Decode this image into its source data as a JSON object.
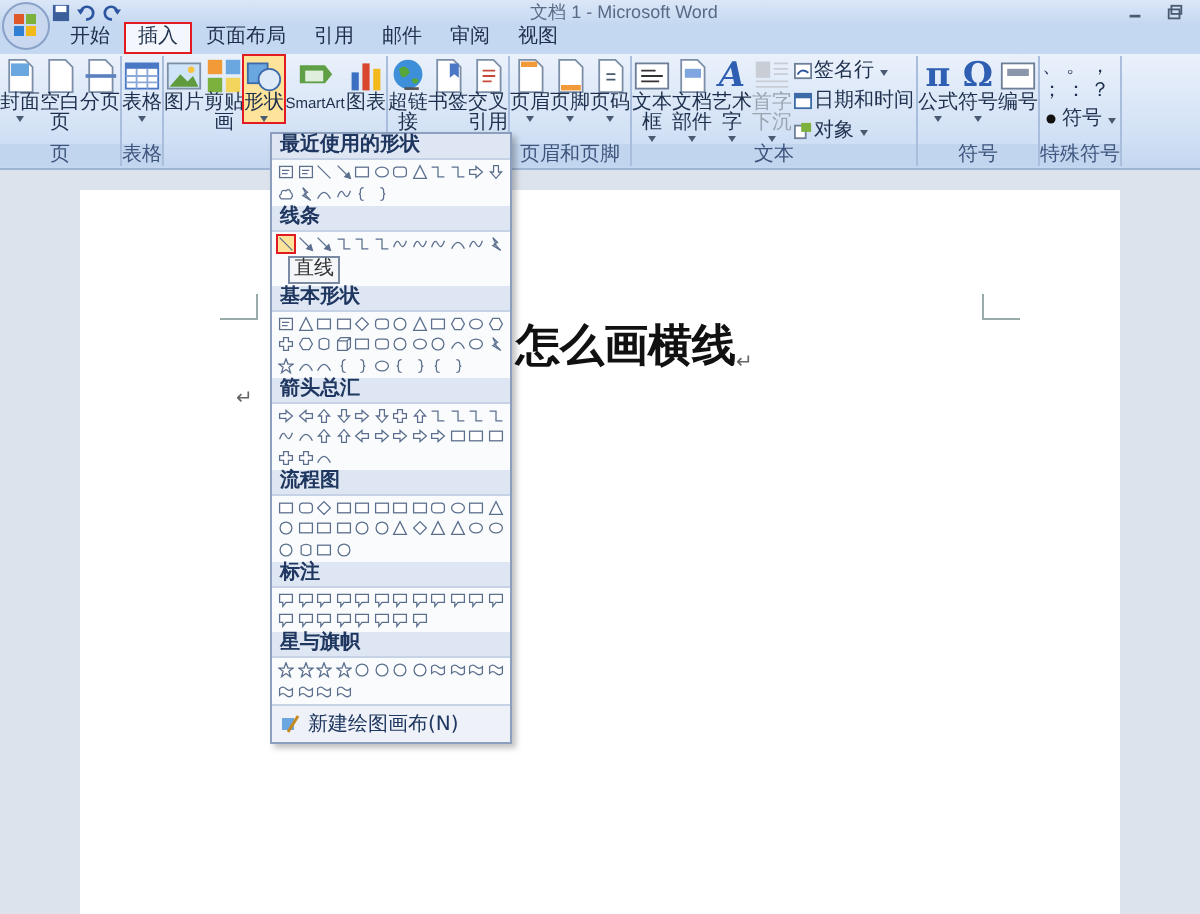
{
  "window": {
    "title": "文档 1 - Microsoft Word"
  },
  "tabs": [
    {
      "label": "开始",
      "selected": false
    },
    {
      "label": "插入",
      "selected": true
    },
    {
      "label": "页面布局",
      "selected": false
    },
    {
      "label": "引用",
      "selected": false
    },
    {
      "label": "邮件",
      "selected": false
    },
    {
      "label": "审阅",
      "selected": false
    },
    {
      "label": "视图",
      "selected": false
    }
  ],
  "ribbon": {
    "groups": [
      {
        "label": "页",
        "buttons": [
          {
            "kind": "large",
            "label": "封面",
            "dropdown": true,
            "selected": false,
            "disabled": false
          },
          {
            "kind": "large",
            "label": "空白页",
            "dropdown": false,
            "selected": false,
            "disabled": false
          },
          {
            "kind": "large",
            "label": "分页",
            "dropdown": false,
            "selected": false,
            "disabled": false
          }
        ]
      },
      {
        "label": "表格",
        "buttons": [
          {
            "kind": "large",
            "label": "表格",
            "dropdown": true,
            "selected": false,
            "disabled": false
          }
        ]
      },
      {
        "buttons": [
          {
            "kind": "large",
            "label": "图片",
            "dropdown": false,
            "selected": false,
            "disabled": false
          },
          {
            "kind": "large",
            "label": "剪贴画",
            "dropdown": false,
            "selected": false,
            "disabled": false
          },
          {
            "kind": "large",
            "label": "形状",
            "dropdown": true,
            "selected": true,
            "disabled": false
          },
          {
            "kind": "large",
            "label": "SmartArt",
            "dropdown": false,
            "selected": false,
            "disabled": false
          },
          {
            "kind": "large",
            "label": "图表",
            "dropdown": false,
            "selected": false,
            "disabled": false
          }
        ]
      },
      {
        "buttons": [
          {
            "kind": "large",
            "label": "超链接",
            "dropdown": false,
            "selected": false,
            "disabled": false
          },
          {
            "kind": "large",
            "label": "书签",
            "dropdown": false,
            "selected": false,
            "disabled": false
          },
          {
            "kind": "large",
            "label": "交叉引用",
            "dropdown": false,
            "selected": false,
            "disabled": false
          }
        ]
      },
      {
        "label": "页眉和页脚",
        "buttons": [
          {
            "kind": "large",
            "label": "页眉",
            "dropdown": true,
            "selected": false,
            "disabled": false
          },
          {
            "kind": "large",
            "label": "页脚",
            "dropdown": true,
            "selected": false,
            "disabled": false
          },
          {
            "kind": "large",
            "label": "页码",
            "dropdown": true,
            "selected": false,
            "disabled": false
          }
        ]
      },
      {
        "label": "文本",
        "buttons": [
          {
            "kind": "large",
            "label": "文本框",
            "dropdown": true,
            "selected": false,
            "disabled": false
          },
          {
            "kind": "large",
            "label": "文档部件",
            "dropdown": true,
            "selected": false,
            "disabled": false
          },
          {
            "kind": "large",
            "label": "艺术字",
            "glyph": "A",
            "dropdown": true,
            "selected": false,
            "disabled": false
          },
          {
            "kind": "large",
            "label": "首字下沉",
            "dropdown": true,
            "selected": false,
            "disabled": true
          },
          {
            "kind": "small",
            "label": "签名行",
            "dropdown": true,
            "selected": false,
            "disabled": false
          },
          {
            "kind": "small",
            "label": "日期和时间",
            "dropdown": false,
            "selected": false,
            "disabled": false
          },
          {
            "kind": "small",
            "label": "对象",
            "dropdown": true,
            "selected": false,
            "disabled": false
          }
        ]
      },
      {
        "label": "符号",
        "buttons": [
          {
            "kind": "large",
            "label": "公式",
            "glyph": "π",
            "dropdown": true,
            "selected": false,
            "disabled": false
          },
          {
            "kind": "large",
            "label": "符号",
            "glyph": "Ω",
            "dropdown": true,
            "selected": false,
            "disabled": false
          },
          {
            "kind": "large",
            "label": "编号",
            "dropdown": false,
            "selected": false,
            "disabled": false
          }
        ]
      },
      {
        "label": "特殊符号",
        "symbols": [
          "、",
          "。",
          "，",
          "；",
          "：",
          "？"
        ],
        "buttons": [
          {
            "kind": "small",
            "label": "符号",
            "dropdown": true,
            "selected": false,
            "disabled": false
          }
        ]
      }
    ]
  },
  "shapes_menu": {
    "sections": [
      {
        "title": "最近使用的形状",
        "shapes": [
          {
            "kind": "textbox",
            "selected": false
          },
          {
            "kind": "textbox",
            "selected": false
          },
          {
            "kind": "line",
            "selected": false
          },
          {
            "kind": "aline",
            "selected": false
          },
          {
            "kind": "rect",
            "selected": false
          },
          {
            "kind": "oval",
            "selected": false
          },
          {
            "kind": "rrect",
            "selected": false
          },
          {
            "kind": "tri",
            "selected": false
          },
          {
            "kind": "elbow",
            "selected": false
          },
          {
            "kind": "elbow",
            "selected": false
          },
          {
            "kind": "rarrow",
            "selected": false
          },
          {
            "kind": "darrow",
            "selected": false
          },
          {
            "kind": "cloud",
            "selected": false
          },
          {
            "kind": "bolt",
            "selected": false
          },
          {
            "kind": "arc",
            "selected": false
          },
          {
            "kind": "curve",
            "selected": false
          },
          {
            "kind": "lbrace",
            "selected": false
          },
          {
            "kind": "rbrace",
            "selected": false
          }
        ]
      },
      {
        "title": "线条",
        "shapes": [
          {
            "kind": "line",
            "selected": true
          },
          {
            "kind": "aline",
            "selected": false
          },
          {
            "kind": "aline",
            "selected": false
          },
          {
            "kind": "elbow",
            "selected": false
          },
          {
            "kind": "elbow",
            "selected": false
          },
          {
            "kind": "elbow",
            "selected": false
          },
          {
            "kind": "curve",
            "selected": false
          },
          {
            "kind": "curve",
            "selected": false
          },
          {
            "kind": "curve",
            "selected": false
          },
          {
            "kind": "arc",
            "selected": false
          },
          {
            "kind": "curve",
            "selected": false
          },
          {
            "kind": "bolt",
            "selected": false
          }
        ]
      },
      {
        "title": "基本形状",
        "shapes": [
          {
            "kind": "textbox",
            "selected": false
          },
          {
            "kind": "tri",
            "selected": false
          },
          {
            "kind": "rect",
            "selected": false
          },
          {
            "kind": "rect",
            "selected": false
          },
          {
            "kind": "diamond",
            "selected": false
          },
          {
            "kind": "rrect",
            "selected": false
          },
          {
            "kind": "circle",
            "selected": false
          },
          {
            "kind": "tri",
            "selected": false
          },
          {
            "kind": "rect",
            "selected": false
          },
          {
            "kind": "hex",
            "selected": false
          },
          {
            "kind": "oval",
            "selected": false
          },
          {
            "kind": "hex",
            "selected": false
          },
          {
            "kind": "plus",
            "selected": false
          },
          {
            "kind": "hex",
            "selected": false
          },
          {
            "kind": "cyl",
            "selected": false
          },
          {
            "kind": "cube",
            "selected": false
          },
          {
            "kind": "rect",
            "selected": false
          },
          {
            "kind": "rrect",
            "selected": false
          },
          {
            "kind": "circle",
            "selected": false
          },
          {
            "kind": "oval",
            "selected": false
          },
          {
            "kind": "circle",
            "selected": false
          },
          {
            "kind": "arc",
            "selected": false
          },
          {
            "kind": "oval",
            "selected": false
          },
          {
            "kind": "bolt",
            "selected": false
          },
          {
            "kind": "star",
            "selected": false
          },
          {
            "kind": "arc",
            "selected": false
          },
          {
            "kind": "arc",
            "selected": false
          },
          {
            "kind": "lbrace",
            "selected": false
          },
          {
            "kind": "rbrace",
            "selected": false
          },
          {
            "kind": "oval",
            "selected": false
          },
          {
            "kind": "lbrace",
            "selected": false
          },
          {
            "kind": "rbrace",
            "selected": false
          },
          {
            "kind": "lbrace",
            "selected": false
          },
          {
            "kind": "rbrace",
            "selected": false
          }
        ]
      },
      {
        "title": "箭头总汇",
        "shapes": [
          {
            "kind": "rarrow",
            "selected": false
          },
          {
            "kind": "larrow",
            "selected": false
          },
          {
            "kind": "uarrow",
            "selected": false
          },
          {
            "kind": "darrow",
            "selected": false
          },
          {
            "kind": "rarrow",
            "selected": false
          },
          {
            "kind": "darrow",
            "selected": false
          },
          {
            "kind": "plus",
            "selected": false
          },
          {
            "kind": "uarrow",
            "selected": false
          },
          {
            "kind": "elbow",
            "selected": false
          },
          {
            "kind": "elbow",
            "selected": false
          },
          {
            "kind": "elbow",
            "selected": false
          },
          {
            "kind": "elbow",
            "selected": false
          },
          {
            "kind": "curve",
            "selected": false
          },
          {
            "kind": "arc",
            "selected": false
          },
          {
            "kind": "uarrow",
            "selected": false
          },
          {
            "kind": "uarrow",
            "selected": false
          },
          {
            "kind": "larrow",
            "selected": false
          },
          {
            "kind": "rarrow",
            "selected": false
          },
          {
            "kind": "rarrow",
            "selected": false
          },
          {
            "kind": "rarrow",
            "selected": false
          },
          {
            "kind": "rarrow",
            "selected": false
          },
          {
            "kind": "rect",
            "selected": false
          },
          {
            "kind": "rect",
            "selected": false
          },
          {
            "kind": "rect",
            "selected": false
          },
          {
            "kind": "plus",
            "selected": false
          },
          {
            "kind": "plus",
            "selected": false
          },
          {
            "kind": "arc",
            "selected": false
          }
        ]
      },
      {
        "title": "流程图",
        "shapes": [
          {
            "kind": "rect",
            "selected": false
          },
          {
            "kind": "rrect",
            "selected": false
          },
          {
            "kind": "diamond",
            "selected": false
          },
          {
            "kind": "rect",
            "selected": false
          },
          {
            "kind": "rect",
            "selected": false
          },
          {
            "kind": "rect",
            "selected": false
          },
          {
            "kind": "rect",
            "selected": false
          },
          {
            "kind": "rect",
            "selected": false
          },
          {
            "kind": "rrect",
            "selected": false
          },
          {
            "kind": "oval",
            "selected": false
          },
          {
            "kind": "rect",
            "selected": false
          },
          {
            "kind": "tri",
            "selected": false
          },
          {
            "kind": "circle",
            "selected": false
          },
          {
            "kind": "rect",
            "selected": false
          },
          {
            "kind": "rect",
            "selected": false
          },
          {
            "kind": "rect",
            "selected": false
          },
          {
            "kind": "circle",
            "selected": false
          },
          {
            "kind": "circle",
            "selected": false
          },
          {
            "kind": "tri",
            "selected": false
          },
          {
            "kind": "diamond",
            "selected": false
          },
          {
            "kind": "tri",
            "selected": false
          },
          {
            "kind": "tri",
            "selected": false
          },
          {
            "kind": "oval",
            "selected": false
          },
          {
            "kind": "oval",
            "selected": false
          },
          {
            "kind": "circle",
            "selected": false
          },
          {
            "kind": "cyl",
            "selected": false
          },
          {
            "kind": "rect",
            "selected": false
          },
          {
            "kind": "circle",
            "selected": false
          }
        ]
      },
      {
        "title": "标注",
        "shapes": [
          {
            "kind": "callout",
            "selected": false
          },
          {
            "kind": "callout",
            "selected": false
          },
          {
            "kind": "callout",
            "selected": false
          },
          {
            "kind": "callout",
            "selected": false
          },
          {
            "kind": "callout",
            "selected": false
          },
          {
            "kind": "callout",
            "selected": false
          },
          {
            "kind": "callout",
            "selected": false
          },
          {
            "kind": "callout",
            "selected": false
          },
          {
            "kind": "callout",
            "selected": false
          },
          {
            "kind": "callout",
            "selected": false
          },
          {
            "kind": "callout",
            "selected": false
          },
          {
            "kind": "callout",
            "selected": false
          },
          {
            "kind": "callout",
            "selected": false
          },
          {
            "kind": "callout",
            "selected": false
          },
          {
            "kind": "callout",
            "selected": false
          },
          {
            "kind": "callout",
            "selected": false
          },
          {
            "kind": "callout",
            "selected": false
          },
          {
            "kind": "callout",
            "selected": false
          },
          {
            "kind": "callout",
            "selected": false
          },
          {
            "kind": "callout",
            "selected": false
          }
        ]
      },
      {
        "title": "星与旗帜",
        "shapes": [
          {
            "kind": "star",
            "selected": false
          },
          {
            "kind": "star",
            "selected": false
          },
          {
            "kind": "star",
            "selected": false
          },
          {
            "kind": "star",
            "selected": false
          },
          {
            "kind": "circle",
            "selected": false
          },
          {
            "kind": "circle",
            "selected": false
          },
          {
            "kind": "circle",
            "selected": false
          },
          {
            "kind": "circle",
            "selected": false
          },
          {
            "kind": "flag",
            "selected": false
          },
          {
            "kind": "flag",
            "selected": false
          },
          {
            "kind": "flag",
            "selected": false
          },
          {
            "kind": "flag",
            "selected": false
          },
          {
            "kind": "flag",
            "selected": false
          },
          {
            "kind": "flag",
            "selected": false
          },
          {
            "kind": "flag",
            "selected": false
          },
          {
            "kind": "flag",
            "selected": false
          }
        ]
      }
    ],
    "tooltip": "直线",
    "footer": "新建绘图画布(N)"
  },
  "document": {
    "heading": "怎么画横线",
    "heading_mark": "↵",
    "paragraph_mark": "↵"
  }
}
